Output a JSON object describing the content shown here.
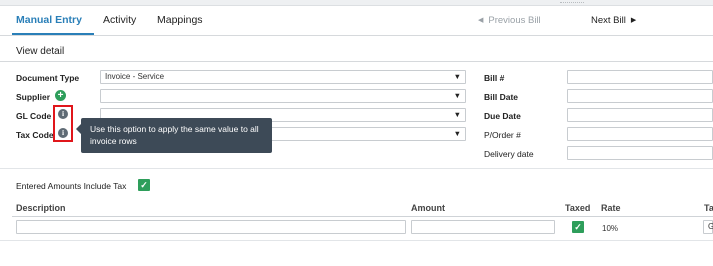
{
  "tabs": {
    "manual_entry": "Manual Entry",
    "activity": "Activity",
    "mappings": "Mappings"
  },
  "nav": {
    "prev_label": "Previous Bill",
    "next_label": "Next Bill",
    "prev_icon": "◀",
    "next_icon": "▶"
  },
  "view_detail": "View detail",
  "form": {
    "document_type_label": "Document Type",
    "document_type_value": "Invoice - Service",
    "supplier_label": "Supplier",
    "gl_code_label": "GL Code",
    "tax_code_label": "Tax Code",
    "bill_no_label": "Bill #",
    "bill_date_label": "Bill Date",
    "due_date_label": "Due Date",
    "po_label": "P/Order #",
    "delivery_date_label": "Delivery date",
    "caret": "▼",
    "plus_symbol": "+",
    "info_symbol": "i"
  },
  "tooltip": {
    "text": "Use this option to apply the same value to all invoice rows"
  },
  "amounts_include_tax": {
    "label": "Entered Amounts Include Tax",
    "checked": true,
    "check_symbol": "✓"
  },
  "table": {
    "headers": {
      "description": "Description",
      "amount": "Amount",
      "taxed": "Taxed",
      "rate": "Rate",
      "tax_cut": "Ta"
    },
    "row": {
      "taxed": true,
      "rate": "10%",
      "tax_cut_value": "G"
    }
  },
  "colors": {
    "accent": "#2a7fb8",
    "success": "#2e9e5b",
    "tooltip_bg": "#3d4a57",
    "highlight": "#e0161b"
  },
  "icons": {
    "supplier_add": "plus-circle-icon",
    "info": "info-icon",
    "check": "checkmark-icon",
    "caret": "caret-down-icon"
  }
}
